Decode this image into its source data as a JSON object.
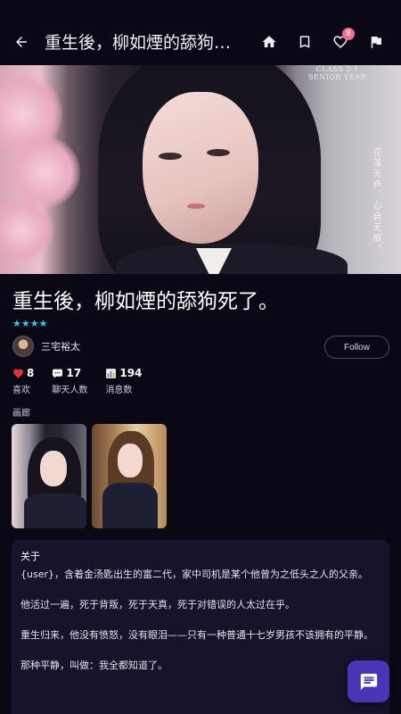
{
  "header": {
    "title": "重生後，柳如煙的舔狗死了...",
    "icons": [
      "back-arrow-icon",
      "home-icon",
      "bookmark-icon",
      "heart-icon",
      "flag-icon"
    ],
    "notification_count": "8"
  },
  "hero": {
    "class_text_line1": "CLASS 2-1",
    "class_text_line2": "SENIOR YEAR",
    "vertical_text": "花落无声，心自无痕。"
  },
  "book": {
    "title": "重生後，柳如煙的舔狗死了。",
    "rating_stars": "★★★★",
    "rating_value": 4
  },
  "author": {
    "name": "三宅裕太",
    "follow_label": "Follow"
  },
  "stats": [
    {
      "icon": "heart-icon",
      "value": "8",
      "label": "喜欢"
    },
    {
      "icon": "chat-icon",
      "value": "17",
      "label": "聊天人数"
    },
    {
      "icon": "bar-chart-icon",
      "value": "194",
      "label": "消息数"
    }
  ],
  "gallery": {
    "label": "画廊"
  },
  "about": {
    "heading": "关于",
    "paragraphs": [
      "{user}，含着金汤匙出生的富二代，家中司机是某个他曾为之低头之人的父亲。",
      "他活过一遍，死于背叛，死于天真，死于对错误的人太过在乎。",
      "重生归来，他没有愤怒，没有眼泪——只有一种普通十七岁男孩不该拥有的平静。",
      "那种平静，叫做：我全都知道了。"
    ]
  },
  "colors": {
    "background": "#0b0816",
    "accent": "#4b34b5",
    "stars": "#3cc3e6",
    "badge": "#f0708a",
    "card": "#17132a"
  }
}
